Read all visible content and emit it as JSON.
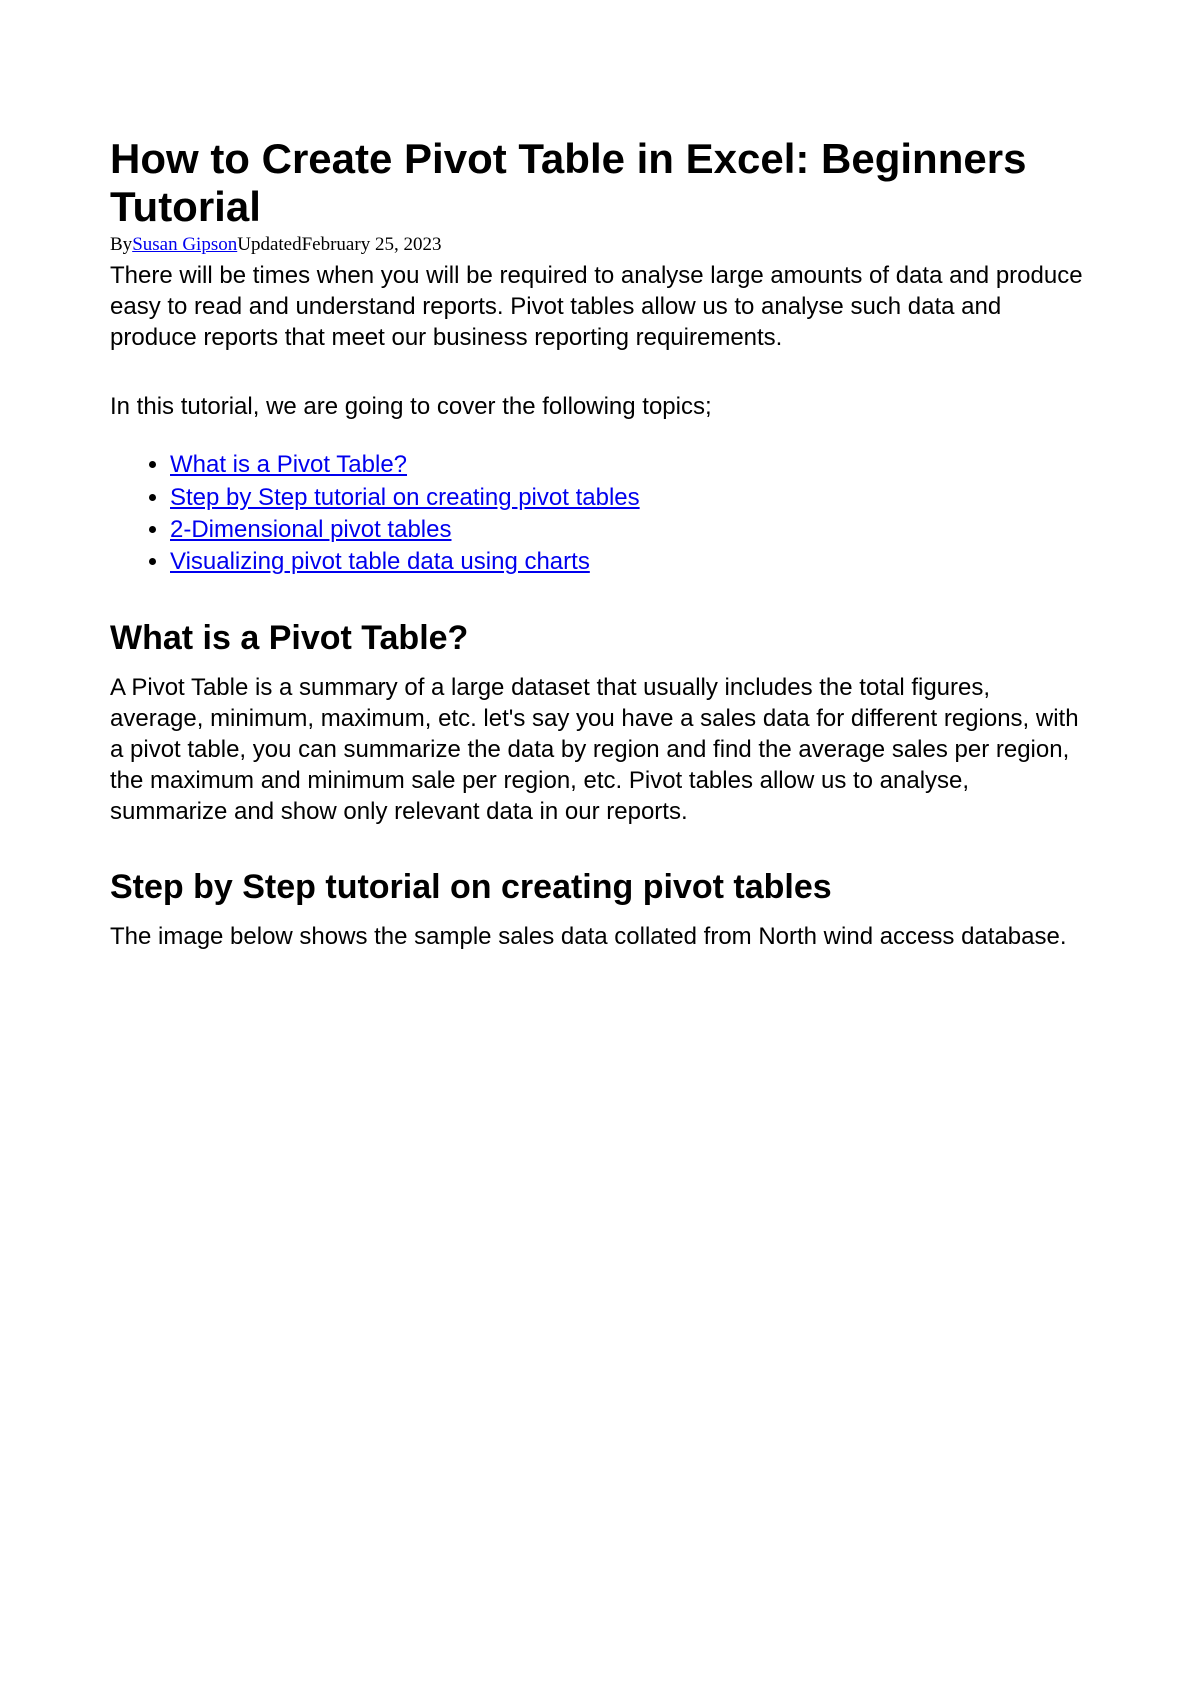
{
  "title": "How to Create Pivot Table in Excel: Beginners Tutorial",
  "byline": {
    "by": "By",
    "author": "Susan Gipson",
    "updated": "Updated",
    "date": "February 25, 2023"
  },
  "intro": "There will be times when you will be required to analyse large amounts of data and produce easy to read and understand reports. Pivot tables allow us to analyse such data and produce reports that meet our business reporting requirements.",
  "topics_intro": "In this tutorial, we are going to cover the following topics;",
  "toc": [
    "What is a Pivot Table?",
    "Step by Step tutorial on creating pivot tables",
    "2-Dimensional pivot tables",
    "Visualizing pivot table data using charts"
  ],
  "section1": {
    "heading": "What is a Pivot Table?",
    "body": "A Pivot Table is a summary of a large dataset that usually includes the total figures, average, minimum, maximum, etc. let's say you have a sales data for different regions, with a pivot table, you can summarize the data by region and find the average sales per region, the maximum and minimum sale per region, etc. Pivot tables allow us to analyse, summarize and show only relevant data in our reports."
  },
  "section2": {
    "heading": "Step by Step tutorial on creating pivot tables",
    "body": "The image below shows the sample sales data collated from North wind access database."
  }
}
